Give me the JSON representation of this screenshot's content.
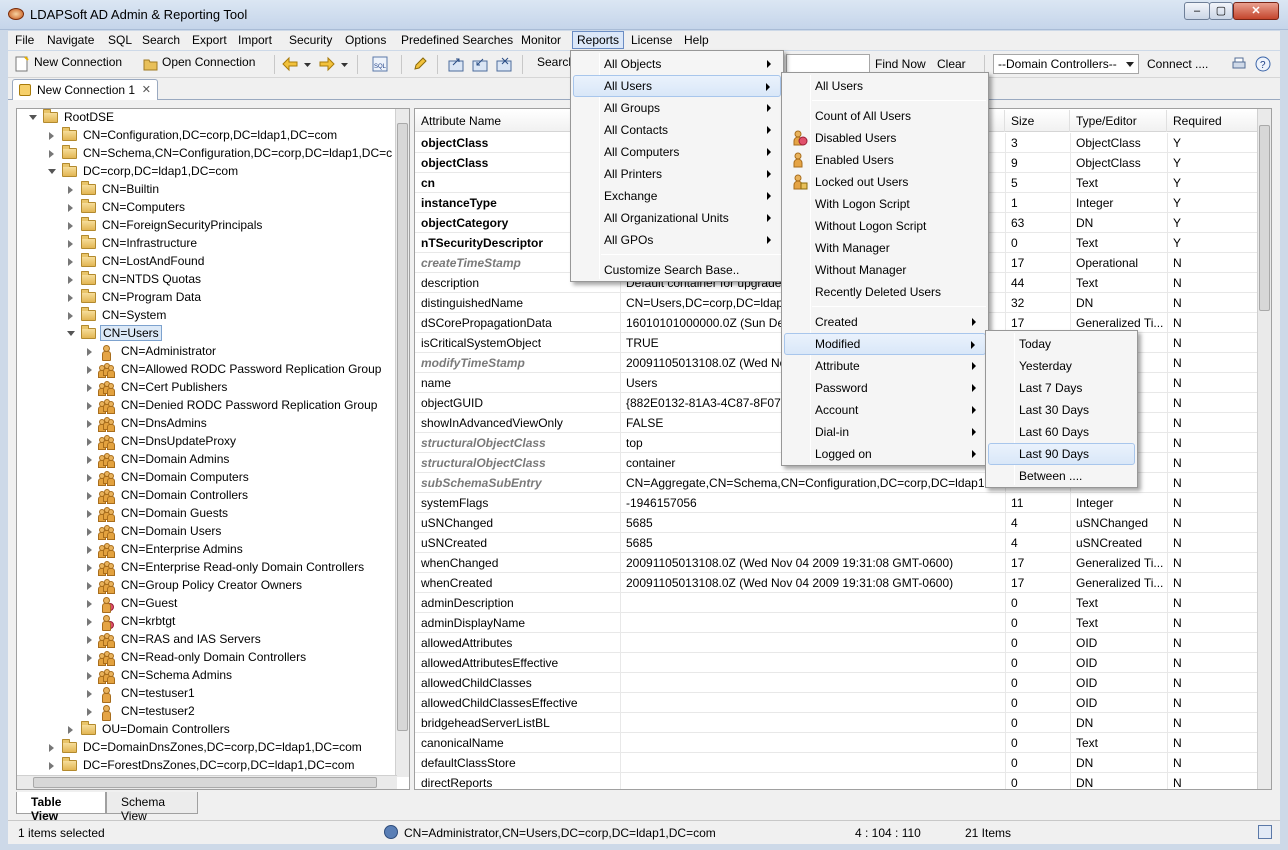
{
  "window": {
    "title": "LDAPSoft AD Admin & Reporting Tool",
    "controls": [
      "–",
      "▢",
      "✕"
    ]
  },
  "menubar": [
    "File",
    "Navigate",
    "SQL",
    "Search",
    "Export",
    "Import",
    "Security",
    "Options",
    "Predefined Searches",
    "Monitor",
    "Reports",
    "License",
    "Help"
  ],
  "toolbar": {
    "new_connection": "New Connection",
    "open_connection": "Open Connection",
    "search_label": "Search",
    "find_now": "Find Now",
    "clear": "Clear",
    "domain_select": "--Domain Controllers--",
    "connect": "Connect ...."
  },
  "doc_tab": {
    "label": "New Connection 1"
  },
  "tree": [
    {
      "label": "RootDSE",
      "level": 0,
      "kind": "folder",
      "open": true
    },
    {
      "label": "CN=Configuration,DC=corp,DC=ldap1,DC=com",
      "level": 1,
      "kind": "folder",
      "open": false
    },
    {
      "label": "CN=Schema,CN=Configuration,DC=corp,DC=ldap1,DC=c",
      "level": 1,
      "kind": "folder",
      "open": false
    },
    {
      "label": "DC=corp,DC=ldap1,DC=com",
      "level": 1,
      "kind": "folder",
      "open": true
    },
    {
      "label": "CN=Builtin",
      "level": 2,
      "kind": "folder",
      "open": false
    },
    {
      "label": "CN=Computers",
      "level": 2,
      "kind": "folder",
      "open": false
    },
    {
      "label": "CN=ForeignSecurityPrincipals",
      "level": 2,
      "kind": "folder",
      "open": false
    },
    {
      "label": "CN=Infrastructure",
      "level": 2,
      "kind": "folder",
      "open": false
    },
    {
      "label": "CN=LostAndFound",
      "level": 2,
      "kind": "folder",
      "open": false
    },
    {
      "label": "CN=NTDS Quotas",
      "level": 2,
      "kind": "folder",
      "open": false
    },
    {
      "label": "CN=Program Data",
      "level": 2,
      "kind": "folder",
      "open": false
    },
    {
      "label": "CN=System",
      "level": 2,
      "kind": "folder",
      "open": false
    },
    {
      "label": "CN=Users",
      "level": 2,
      "kind": "folder",
      "open": true,
      "selected": true
    },
    {
      "label": "CN=Administrator",
      "level": 3,
      "kind": "user"
    },
    {
      "label": "CN=Allowed RODC Password Replication Group",
      "level": 3,
      "kind": "group"
    },
    {
      "label": "CN=Cert Publishers",
      "level": 3,
      "kind": "group"
    },
    {
      "label": "CN=Denied RODC Password Replication Group",
      "level": 3,
      "kind": "group"
    },
    {
      "label": "CN=DnsAdmins",
      "level": 3,
      "kind": "group"
    },
    {
      "label": "CN=DnsUpdateProxy",
      "level": 3,
      "kind": "group"
    },
    {
      "label": "CN=Domain Admins",
      "level": 3,
      "kind": "group"
    },
    {
      "label": "CN=Domain Computers",
      "level": 3,
      "kind": "group"
    },
    {
      "label": "CN=Domain Controllers",
      "level": 3,
      "kind": "group"
    },
    {
      "label": "CN=Domain Guests",
      "level": 3,
      "kind": "group"
    },
    {
      "label": "CN=Domain Users",
      "level": 3,
      "kind": "group"
    },
    {
      "label": "CN=Enterprise Admins",
      "level": 3,
      "kind": "group"
    },
    {
      "label": "CN=Enterprise Read-only Domain Controllers",
      "level": 3,
      "kind": "group"
    },
    {
      "label": "CN=Group Policy Creator Owners",
      "level": 3,
      "kind": "group"
    },
    {
      "label": "CN=Guest",
      "level": 3,
      "kind": "user-disabled"
    },
    {
      "label": "CN=krbtgt",
      "level": 3,
      "kind": "user-disabled"
    },
    {
      "label": "CN=RAS and IAS Servers",
      "level": 3,
      "kind": "group"
    },
    {
      "label": "CN=Read-only Domain Controllers",
      "level": 3,
      "kind": "group"
    },
    {
      "label": "CN=Schema Admins",
      "level": 3,
      "kind": "group"
    },
    {
      "label": "CN=testuser1",
      "level": 3,
      "kind": "user"
    },
    {
      "label": "CN=testuser2",
      "level": 3,
      "kind": "user"
    },
    {
      "label": "OU=Domain Controllers",
      "level": 2,
      "kind": "folder",
      "open": false
    },
    {
      "label": "DC=DomainDnsZones,DC=corp,DC=ldap1,DC=com",
      "level": 1,
      "kind": "folder",
      "open": false
    },
    {
      "label": "DC=ForestDnsZones,DC=corp,DC=ldap1,DC=com",
      "level": 1,
      "kind": "folder",
      "open": false
    }
  ],
  "table": {
    "columns": [
      "Attribute Name",
      "",
      "Size",
      "Type/Editor",
      "Required"
    ],
    "rows": [
      {
        "name": "objectClass",
        "style": "bold",
        "value": "",
        "size": "3",
        "type": "ObjectClass",
        "req": "Y"
      },
      {
        "name": "objectClass",
        "style": "bold",
        "value": "",
        "size": "9",
        "type": "ObjectClass",
        "req": "Y"
      },
      {
        "name": "cn",
        "style": "bold",
        "value": "",
        "size": "5",
        "type": "Text",
        "req": "Y"
      },
      {
        "name": "instanceType",
        "style": "bold",
        "value": "",
        "size": "1",
        "type": "Integer",
        "req": "Y"
      },
      {
        "name": "objectCategory",
        "style": "bold",
        "value": "",
        "size": "63",
        "type": "DN",
        "req": "Y"
      },
      {
        "name": "nTSecurityDescriptor",
        "style": "bold",
        "value": "",
        "size": "0",
        "type": "Text",
        "req": "Y"
      },
      {
        "name": "createTimeStamp",
        "style": "italic",
        "value": "",
        "size": "17",
        "type": "Operational",
        "req": "N"
      },
      {
        "name": "description",
        "style": "",
        "value": "Default container for upgrade",
        "size": "44",
        "type": "Text",
        "req": "N"
      },
      {
        "name": "distinguishedName",
        "style": "",
        "value": "CN=Users,DC=corp,DC=ldap1",
        "size": "32",
        "type": "DN",
        "req": "N"
      },
      {
        "name": "dSCorePropagationData",
        "style": "",
        "value": "16010101000000.0Z (Sun Dec 3",
        "size": "17",
        "type": "Generalized Ti...",
        "req": "N"
      },
      {
        "name": "isCriticalSystemObject",
        "style": "",
        "value": "TRUE",
        "size": "",
        "type": "",
        "req": "N"
      },
      {
        "name": "modifyTimeStamp",
        "style": "italic",
        "value": "20091105013108.0Z (Wed Nov",
        "size": "",
        "type": "",
        "req": "N"
      },
      {
        "name": "name",
        "style": "",
        "value": "Users",
        "size": "",
        "type": "",
        "req": "N"
      },
      {
        "name": "objectGUID",
        "style": "",
        "value": "{882E0132-81A3-4C87-8F07-9E",
        "size": "",
        "type": "",
        "req": "N"
      },
      {
        "name": "showInAdvancedViewOnly",
        "style": "",
        "value": "FALSE",
        "size": "",
        "type": "",
        "req": "N"
      },
      {
        "name": "structuralObjectClass",
        "style": "italic",
        "value": "top",
        "size": "",
        "type": "",
        "req": "N"
      },
      {
        "name": "structuralObjectClass",
        "style": "italic",
        "value": "container",
        "size": "",
        "type": "",
        "req": "N"
      },
      {
        "name": "subSchemaSubEntry",
        "style": "italic",
        "value": "CN=Aggregate,CN=Schema,CN=Configuration,DC=corp,DC=ldap1",
        "size": "",
        "type": "",
        "req": "N"
      },
      {
        "name": "systemFlags",
        "style": "",
        "value": "-1946157056",
        "size": "11",
        "type": "Integer",
        "req": "N"
      },
      {
        "name": "uSNChanged",
        "style": "",
        "value": "5685",
        "size": "4",
        "type": "uSNChanged",
        "req": "N"
      },
      {
        "name": "uSNCreated",
        "style": "",
        "value": "5685",
        "size": "4",
        "type": "uSNCreated",
        "req": "N"
      },
      {
        "name": "whenChanged",
        "style": "",
        "value": "20091105013108.0Z (Wed Nov 04 2009 19:31:08 GMT-0600)",
        "size": "17",
        "type": "Generalized Ti...",
        "req": "N"
      },
      {
        "name": "whenCreated",
        "style": "",
        "value": "20091105013108.0Z (Wed Nov 04 2009 19:31:08 GMT-0600)",
        "size": "17",
        "type": "Generalized Ti...",
        "req": "N"
      },
      {
        "name": "adminDescription",
        "style": "",
        "value": "",
        "size": "0",
        "type": "Text",
        "req": "N"
      },
      {
        "name": "adminDisplayName",
        "style": "",
        "value": "",
        "size": "0",
        "type": "Text",
        "req": "N"
      },
      {
        "name": "allowedAttributes",
        "style": "",
        "value": "",
        "size": "0",
        "type": "OID",
        "req": "N"
      },
      {
        "name": "allowedAttributesEffective",
        "style": "",
        "value": "",
        "size": "0",
        "type": "OID",
        "req": "N"
      },
      {
        "name": "allowedChildClasses",
        "style": "",
        "value": "",
        "size": "0",
        "type": "OID",
        "req": "N"
      },
      {
        "name": "allowedChildClassesEffective",
        "style": "",
        "value": "",
        "size": "0",
        "type": "OID",
        "req": "N"
      },
      {
        "name": "bridgeheadServerListBL",
        "style": "",
        "value": "",
        "size": "0",
        "type": "DN",
        "req": "N"
      },
      {
        "name": "canonicalName",
        "style": "",
        "value": "",
        "size": "0",
        "type": "Text",
        "req": "N"
      },
      {
        "name": "defaultClassStore",
        "style": "",
        "value": "",
        "size": "0",
        "type": "DN",
        "req": "N"
      },
      {
        "name": "directReports",
        "style": "",
        "value": "",
        "size": "0",
        "type": "DN",
        "req": "N"
      }
    ]
  },
  "bottom_tabs": [
    "Table View",
    "Schema View"
  ],
  "status": {
    "selected": "1 items selected",
    "dn": "CN=Administrator,CN=Users,DC=corp,DC=ldap1,DC=com",
    "position": "4 : 104 : 110",
    "items": "21 Items"
  },
  "reports_menu": [
    {
      "label": "All Objects",
      "sub": true
    },
    {
      "label": "All Users",
      "sub": true,
      "hl": true
    },
    {
      "label": "All Groups",
      "sub": true
    },
    {
      "label": "All Contacts",
      "sub": true
    },
    {
      "label": "All Computers",
      "sub": true
    },
    {
      "label": "All Printers",
      "sub": true
    },
    {
      "label": "Exchange",
      "sub": true
    },
    {
      "label": "All Organizational Units",
      "sub": true
    },
    {
      "label": "All GPOs",
      "sub": true
    },
    {
      "sep": true
    },
    {
      "label": "Customize Search Base..",
      "sub": false
    }
  ],
  "users_menu": [
    {
      "label": "All Users"
    },
    {
      "sep": true
    },
    {
      "label": "Count of All Users"
    },
    {
      "label": "Disabled Users",
      "icon": "disabled-user-icon"
    },
    {
      "label": "Enabled Users",
      "icon": "user-icon"
    },
    {
      "label": "Locked out Users",
      "icon": "locked-user-icon"
    },
    {
      "label": "With Logon Script"
    },
    {
      "label": "Without Logon Script"
    },
    {
      "label": "With Manager"
    },
    {
      "label": "Without Manager"
    },
    {
      "label": "Recently Deleted Users"
    },
    {
      "sep": true
    },
    {
      "label": "Created",
      "sub": true
    },
    {
      "label": "Modified",
      "sub": true,
      "hl": true
    },
    {
      "label": "Attribute",
      "sub": true
    },
    {
      "label": "Password",
      "sub": true
    },
    {
      "label": "Account",
      "sub": true
    },
    {
      "label": "Dial-in",
      "sub": true
    },
    {
      "label": "Logged on",
      "sub": true
    }
  ],
  "modified_menu": [
    {
      "label": "Today"
    },
    {
      "label": "Yesterday"
    },
    {
      "label": "Last 7 Days"
    },
    {
      "label": "Last 30 Days"
    },
    {
      "label": "Last 60 Days"
    },
    {
      "label": "Last 90 Days",
      "hl": true
    },
    {
      "label": "Between ...."
    }
  ]
}
